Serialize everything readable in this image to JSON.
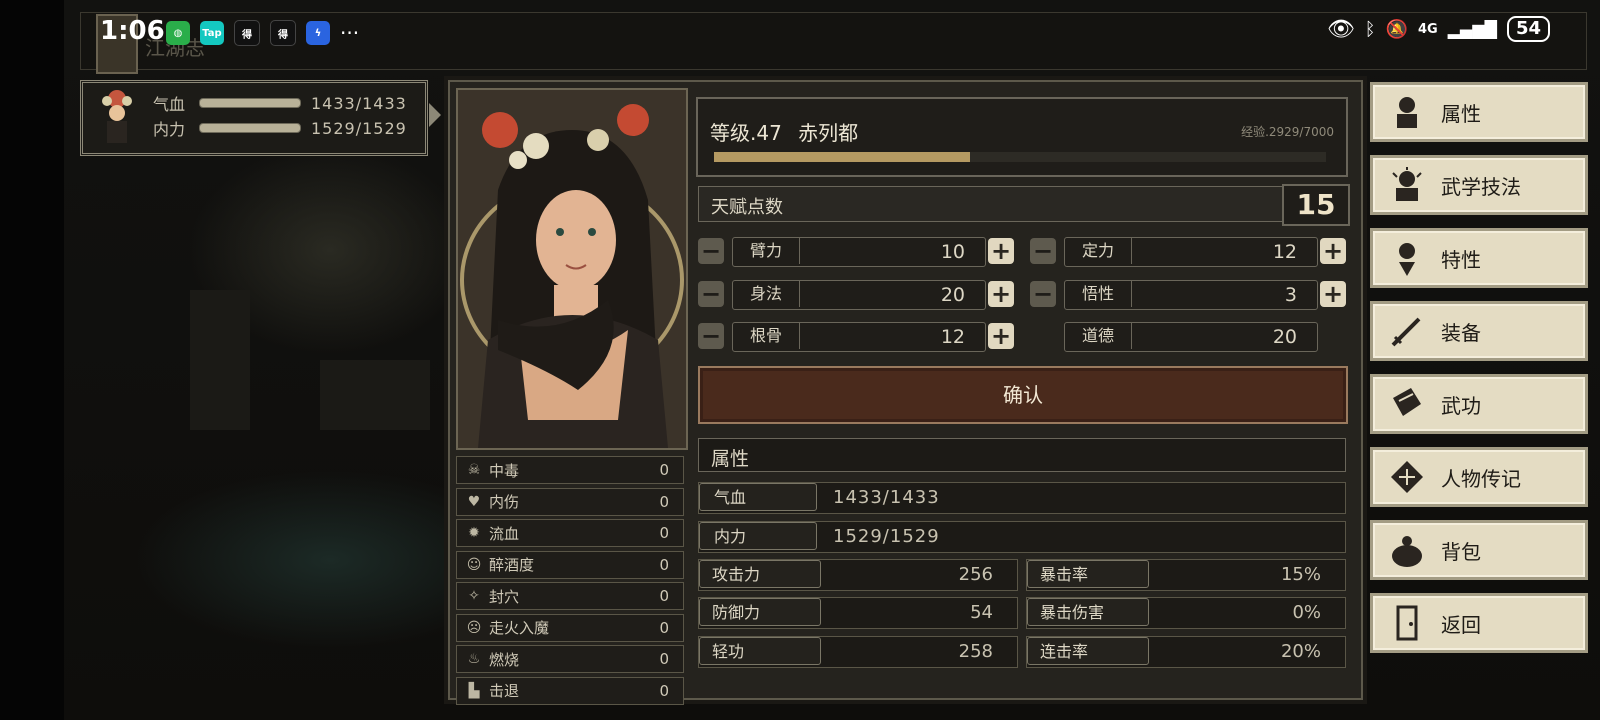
{
  "status_bar": {
    "time": "1:06",
    "apps": [
      "WeChat",
      "Tap",
      "ReqNet",
      "ReqNet",
      "Feather"
    ],
    "battery": "54",
    "network": "4G"
  },
  "quest": {
    "text": "江湖志"
  },
  "hud": {
    "hp_label": "气血",
    "hp_value": "1433/1433",
    "mp_label": "内力",
    "mp_value": "1529/1529"
  },
  "level": {
    "text": "等级.47",
    "name": "赤列都",
    "exp": "经验.2929/7000",
    "exp_fraction": 0.4184
  },
  "talent": {
    "label": "天赋点数",
    "value": "15"
  },
  "stats": {
    "arm": {
      "label": "臂力",
      "value": "10"
    },
    "focus": {
      "label": "定力",
      "value": "12"
    },
    "agility": {
      "label": "身法",
      "value": "20"
    },
    "insight": {
      "label": "悟性",
      "value": "3"
    },
    "bone": {
      "label": "根骨",
      "value": "12"
    },
    "morality": {
      "label": "道德",
      "value": "20"
    }
  },
  "confirm_label": "确认",
  "attributes": {
    "title": "属性",
    "hp": {
      "label": "气血",
      "value": "1433/1433"
    },
    "mp": {
      "label": "内力",
      "value": "1529/1529"
    },
    "attack": {
      "label": "攻击力",
      "value": "256"
    },
    "crit_rate": {
      "label": "暴击率",
      "value": "15%"
    },
    "defense": {
      "label": "防御力",
      "value": "54"
    },
    "crit_dmg": {
      "label": "暴击伤害",
      "value": "0%"
    },
    "lightfoot": {
      "label": "轻功",
      "value": "258"
    },
    "combo": {
      "label": "连击率",
      "value": "20%"
    }
  },
  "status_effects": [
    {
      "name": "中毒",
      "value": "0",
      "icon": "skull-icon"
    },
    {
      "name": "内伤",
      "value": "0",
      "icon": "broken-heart-icon"
    },
    {
      "name": "流血",
      "value": "0",
      "icon": "blood-icon"
    },
    {
      "name": "醉酒度",
      "value": "0",
      "icon": "drunk-face-icon"
    },
    {
      "name": "封穴",
      "value": "0",
      "icon": "acupoint-icon"
    },
    {
      "name": "走火入魔",
      "value": "0",
      "icon": "demon-face-icon"
    },
    {
      "name": "燃烧",
      "value": "0",
      "icon": "fire-icon"
    },
    {
      "name": "击退",
      "value": "0",
      "icon": "boot-icon"
    }
  ],
  "menu": [
    {
      "label": "属性",
      "icon": "character-icon"
    },
    {
      "label": "武学技法",
      "icon": "martial-skill-icon"
    },
    {
      "label": "特性",
      "icon": "trait-icon"
    },
    {
      "label": "装备",
      "icon": "sword-icon"
    },
    {
      "label": "武功",
      "icon": "book-icon"
    },
    {
      "label": "人物传记",
      "icon": "scroll-icon"
    },
    {
      "label": "背包",
      "icon": "bag-icon"
    },
    {
      "label": "返回",
      "icon": "door-icon"
    }
  ]
}
